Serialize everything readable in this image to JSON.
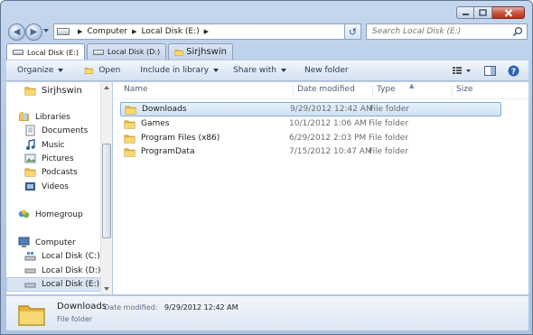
{
  "address": {
    "crumbs": [
      "Computer",
      "Local Disk (E:)"
    ]
  },
  "search": {
    "placeholder": "Search Local Disk (E:)"
  },
  "tabs": [
    {
      "label": "Local Disk (E:)"
    },
    {
      "label": "Local Disk (D:)"
    },
    {
      "label": "Sirjhswin"
    }
  ],
  "toolbar": {
    "organize": "Organize",
    "open": "Open",
    "include": "Include in library",
    "share": "Share with",
    "newfolder": "New folder"
  },
  "navpane": {
    "items": [
      {
        "label": "Sirjhswin",
        "icon": "folder-icon"
      },
      {
        "label": "Libraries",
        "icon": "libraries-icon"
      },
      {
        "label": "Documents",
        "icon": "documents-icon"
      },
      {
        "label": "Music",
        "icon": "music-icon"
      },
      {
        "label": "Pictures",
        "icon": "pictures-icon"
      },
      {
        "label": "Podcasts",
        "icon": "folder-icon"
      },
      {
        "label": "Videos",
        "icon": "videos-icon"
      },
      {
        "label": "Homegroup",
        "icon": "homegroup-icon"
      },
      {
        "label": "Computer",
        "icon": "computer-icon"
      },
      {
        "label": "Local Disk (C:)",
        "icon": "drive-icon"
      },
      {
        "label": "Local Disk (D:)",
        "icon": "drive-icon"
      },
      {
        "label": "Local Disk (E:)",
        "icon": "drive-icon"
      }
    ]
  },
  "columns": {
    "name": "Name",
    "date": "Date modified",
    "type": "Type",
    "size": "Size"
  },
  "files": [
    {
      "name": "Downloads",
      "date": "9/29/2012 12:42 AM",
      "type": "File folder"
    },
    {
      "name": "Games",
      "date": "10/1/2012 1:06 AM",
      "type": "File folder"
    },
    {
      "name": "Program Files (x86)",
      "date": "6/29/2012 2:03 PM",
      "type": "File folder"
    },
    {
      "name": "ProgramData",
      "date": "7/15/2012 10:47 AM",
      "type": "File folder"
    }
  ],
  "details": {
    "name": "Downloads",
    "date_label": "Date modified:",
    "date": "9/29/2012 12:42 AM",
    "type": "File folder"
  },
  "colors": {
    "selection": "#cfe1f6",
    "selection_border": "#84acdd",
    "folder": "#f0c94a",
    "close": "#c8523c"
  }
}
